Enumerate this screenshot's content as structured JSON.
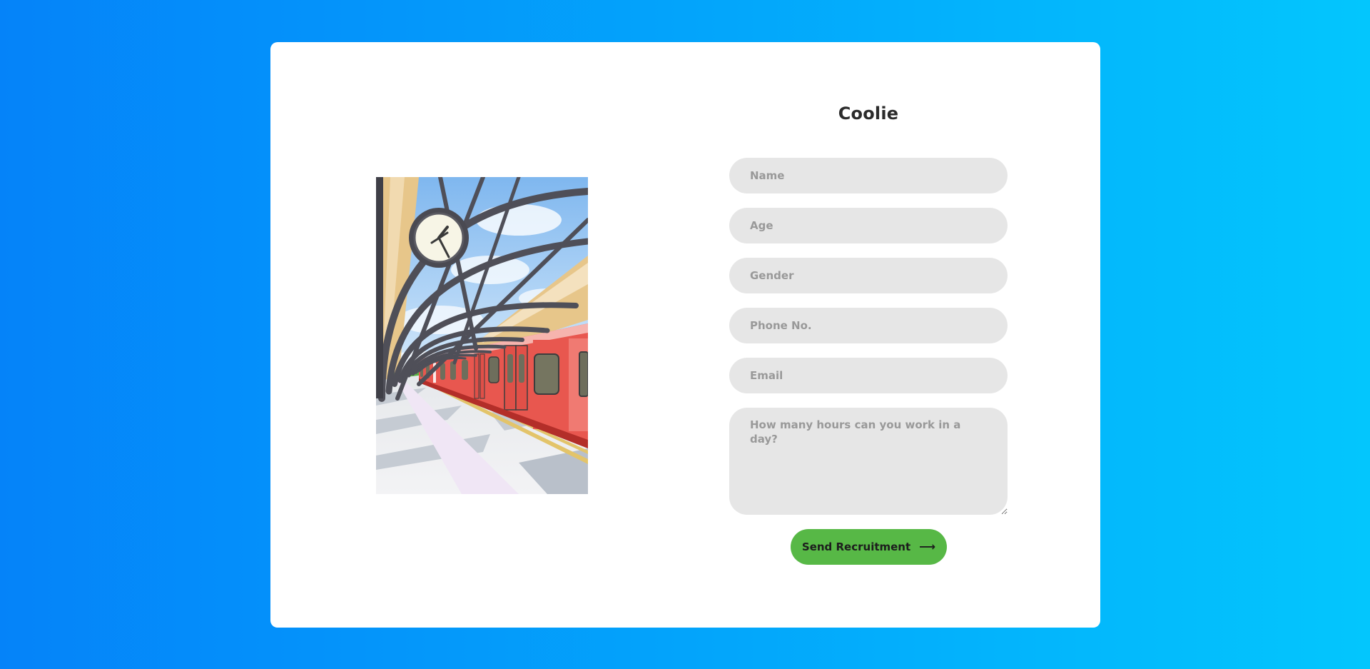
{
  "form": {
    "title": "Coolie",
    "fields": {
      "name": {
        "placeholder": "Name",
        "value": ""
      },
      "age": {
        "placeholder": "Age",
        "value": ""
      },
      "gender": {
        "placeholder": "Gender",
        "value": ""
      },
      "phone": {
        "placeholder": "Phone No.",
        "value": ""
      },
      "email": {
        "placeholder": "Email",
        "value": ""
      },
      "hours": {
        "placeholder": "How many hours can you work in a day?",
        "value": ""
      }
    },
    "submit_label": "Send Recruitment",
    "submit_icon": "arrow-right-icon"
  },
  "illustration": {
    "subject": "railway-station-platform-icon"
  },
  "colors": {
    "background_start": "#0583f9",
    "background_end": "#03c6fd",
    "card": "#ffffff",
    "input_fill": "#e6e6e6",
    "button": "#57b846",
    "train": "#e8574f"
  }
}
